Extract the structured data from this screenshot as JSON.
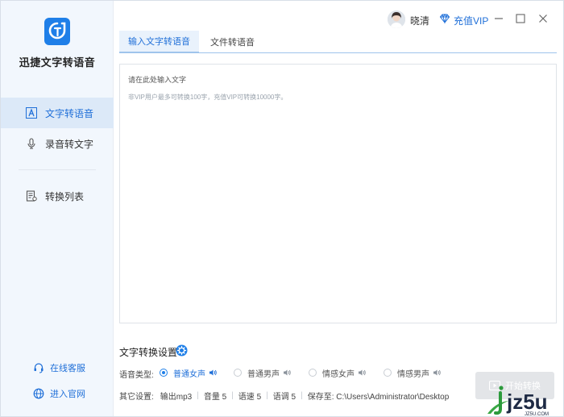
{
  "app": {
    "name": "迅捷文字转语音"
  },
  "sidebar": {
    "items": [
      {
        "label": "文字转语音",
        "icon": "text-a-icon",
        "active": true
      },
      {
        "label": "录音转文字",
        "icon": "microphone-icon",
        "active": false
      },
      {
        "label": "转换列表",
        "icon": "list-doc-icon",
        "active": false
      }
    ],
    "bottom": [
      {
        "label": "在线客服",
        "icon": "headset-icon"
      },
      {
        "label": "进入官网",
        "icon": "globe-icon"
      }
    ]
  },
  "titlebar": {
    "username": "晓清",
    "vip_label": "充值VIP"
  },
  "tabs": [
    {
      "label": "输入文字转语音",
      "active": true
    },
    {
      "label": "文件转语音",
      "active": false
    }
  ],
  "editor": {
    "placeholder": "请在此处输入文字",
    "vip_hint": "非VIP用户最多可转换100字，充值VIP可转换10000字。"
  },
  "settings": {
    "title": "文字转换设置",
    "voice_type_label": "语音类型:",
    "voices": [
      {
        "label": "普通女声",
        "selected": true
      },
      {
        "label": "普通男声",
        "selected": false
      },
      {
        "label": "情感女声",
        "selected": false
      },
      {
        "label": "情感男声",
        "selected": false
      }
    ],
    "other_label": "其它设置:",
    "output": "输出mp3",
    "volume": "音量 5",
    "speed": "语速 5",
    "pitch": "语调 5",
    "save_path": "保存至: C:\\Users\\Administrator\\Desktop"
  },
  "start_button": {
    "label": "开始转换"
  },
  "watermark": {
    "text": "jz5u",
    "sub": "JZ5U.COM"
  },
  "colors": {
    "accent": "#1f7fe8",
    "sidebar_bg": "#f2f7fd",
    "active_bg": "#dce9f8"
  }
}
